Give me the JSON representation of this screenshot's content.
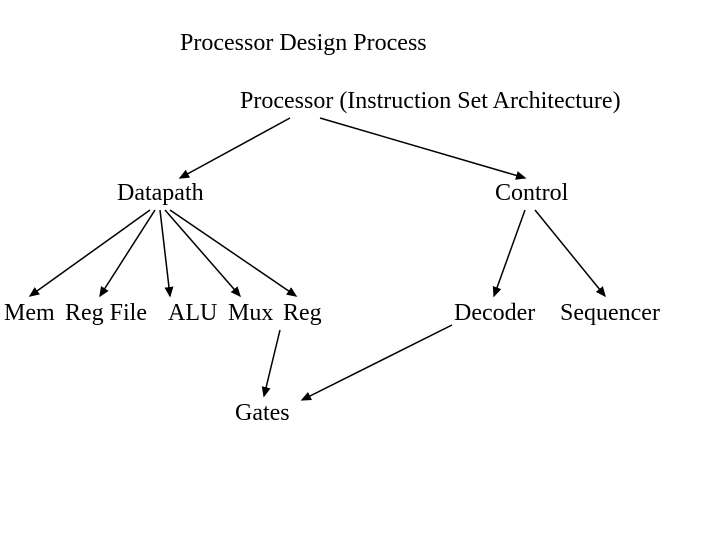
{
  "title": "Processor Design Process",
  "root": "Processor  (Instruction Set Architecture)",
  "branches": {
    "datapath": {
      "label": "Datapath",
      "children": [
        "Mem",
        "Reg File",
        "ALU",
        "Mux",
        "Reg"
      ]
    },
    "control": {
      "label": "Control",
      "children": [
        "Decoder",
        "Sequencer"
      ]
    }
  },
  "leaf": "Gates"
}
